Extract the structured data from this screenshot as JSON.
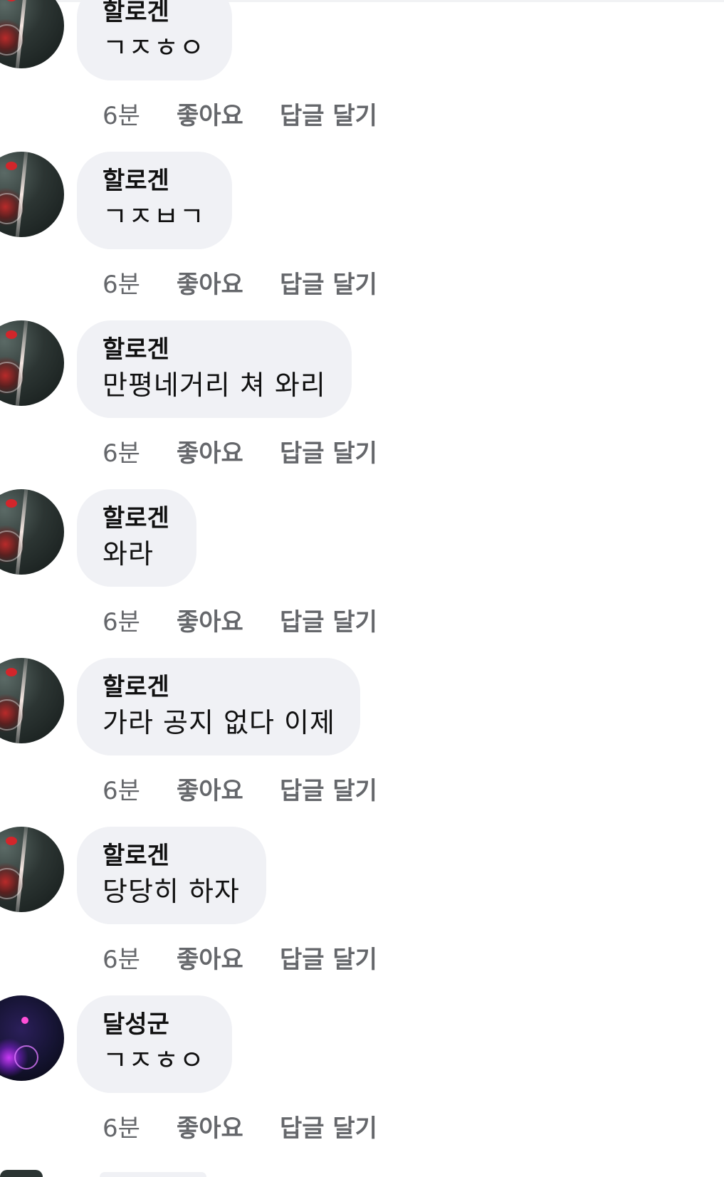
{
  "comments": [
    {
      "author": "할로겐",
      "text": "ㄱㅈㅎㅇ",
      "time": "6분",
      "like": "좋아요",
      "reply": "답글 달기",
      "avatar": "motorcycle-photo-icon"
    },
    {
      "author": "할로겐",
      "text": "ㄱㅈㅂㄱ",
      "time": "6분",
      "like": "좋아요",
      "reply": "답글 달기",
      "avatar": "motorcycle-photo-icon"
    },
    {
      "author": "할로겐",
      "text": "만평네거리 쳐 와리",
      "time": "6분",
      "like": "좋아요",
      "reply": "답글 달기",
      "avatar": "motorcycle-photo-icon"
    },
    {
      "author": "할로겐",
      "text": "와라",
      "time": "6분",
      "like": "좋아요",
      "reply": "답글 달기",
      "avatar": "motorcycle-photo-icon"
    },
    {
      "author": "할로겐",
      "text": "가라 공지 없다 이제",
      "time": "6분",
      "like": "좋아요",
      "reply": "답글 달기",
      "avatar": "motorcycle-photo-icon"
    },
    {
      "author": "할로겐",
      "text": "당당히 하자",
      "time": "6분",
      "like": "좋아요",
      "reply": "답글 달기",
      "avatar": "motorcycle-photo-icon"
    },
    {
      "author": "달성군",
      "text": "ㄱㅈㅎㅇ",
      "time": "6분",
      "like": "좋아요",
      "reply": "답글 달기",
      "avatar": "neon-motorcycle-photo-icon"
    }
  ],
  "colors": {
    "bubble_bg": "#f0f1f5",
    "meta_text": "#65676b",
    "main_text": "#111111"
  }
}
